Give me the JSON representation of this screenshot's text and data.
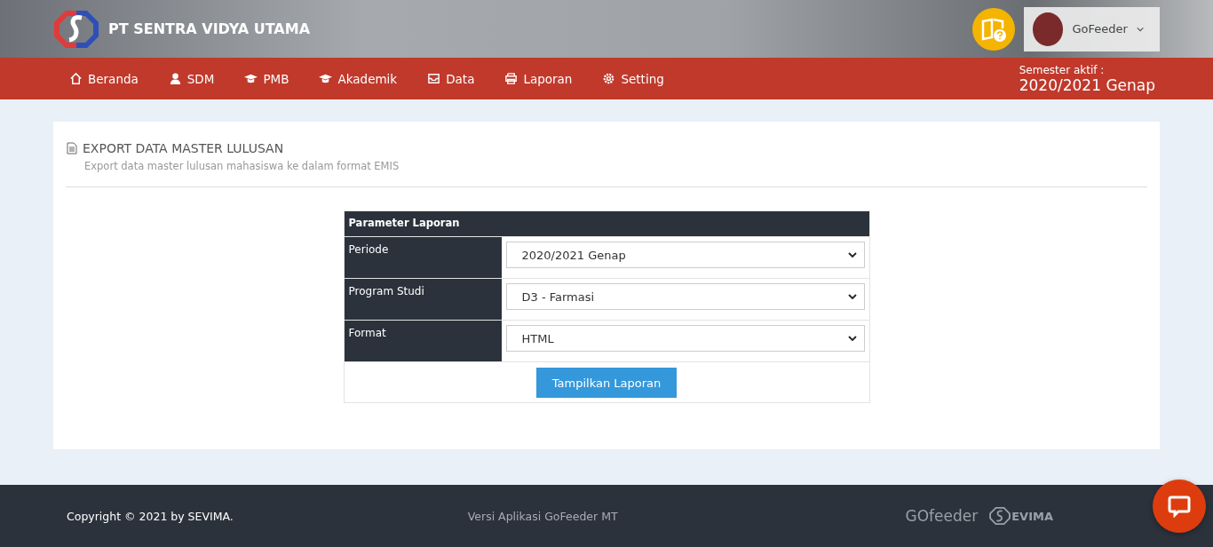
{
  "header": {
    "brand": "PT SENTRA VIDYA UTAMA",
    "user": {
      "name": "GoFeeder"
    }
  },
  "nav": {
    "items": [
      {
        "label": "Beranda"
      },
      {
        "label": "SDM"
      },
      {
        "label": "PMB"
      },
      {
        "label": "Akademik"
      },
      {
        "label": "Data"
      },
      {
        "label": "Laporan"
      },
      {
        "label": "Setting"
      }
    ],
    "semester": {
      "label": "Semester aktif :",
      "value": "2020/2021 Genap"
    }
  },
  "page": {
    "title": "EXPORT DATA MASTER LULUSAN",
    "subtitle": "Export data master lulusan mahasiswa ke dalam format EMIS"
  },
  "form": {
    "heading": "Parameter Laporan",
    "fields": [
      {
        "label": "Periode",
        "value": "2020/2021 Genap"
      },
      {
        "label": "Program Studi",
        "value": "D3 - Farmasi"
      },
      {
        "label": "Format",
        "value": "HTML"
      }
    ],
    "button": "Tampilkan Laporan"
  },
  "footer": {
    "copyright": "Copyright © 2021 by SEVIMA.",
    "version": "Versi Aplikasi GoFeeder MT",
    "logos": [
      "GOfeeder",
      "EVIMA"
    ]
  }
}
